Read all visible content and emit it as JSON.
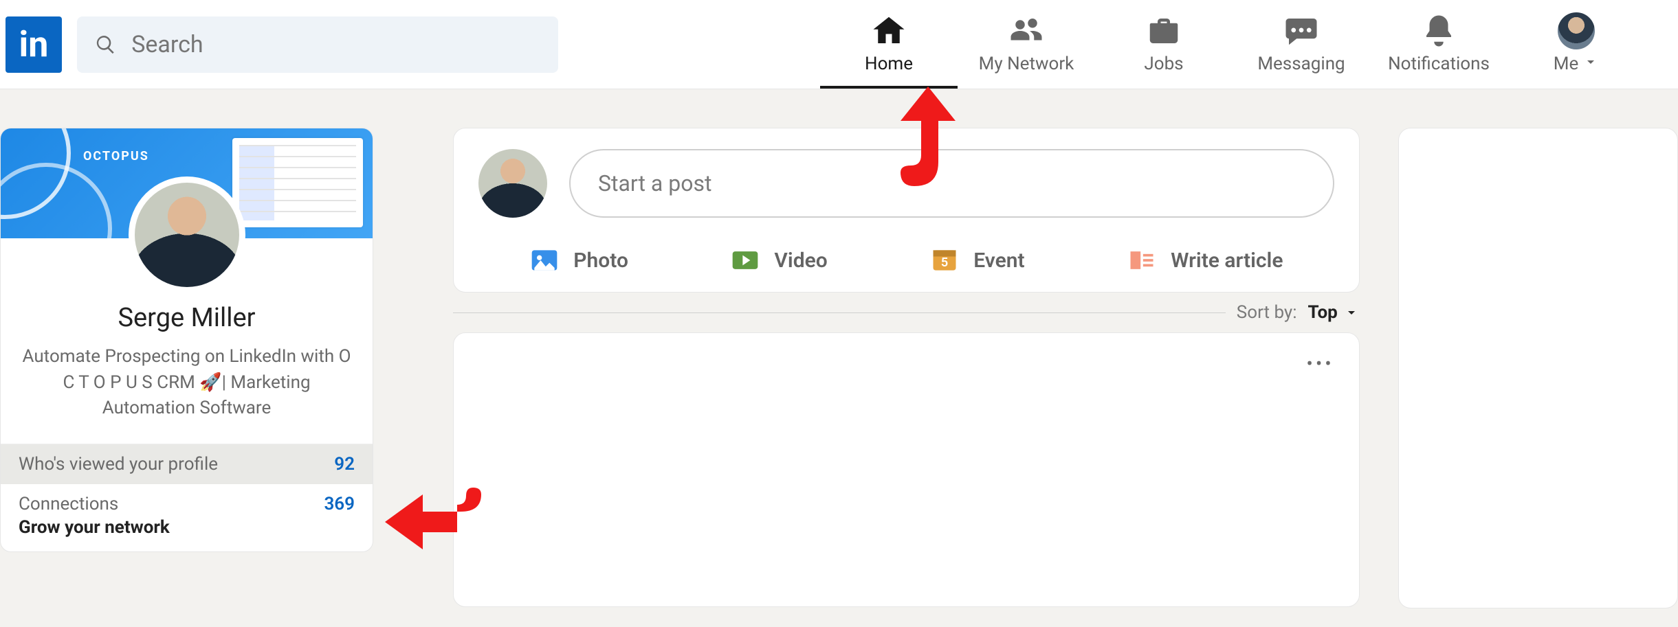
{
  "logo_text": "in",
  "search": {
    "placeholder": "Search"
  },
  "nav": {
    "home": "Home",
    "network": "My Network",
    "jobs": "Jobs",
    "messaging": "Messaging",
    "notifications": "Notifications",
    "me": "Me"
  },
  "profile": {
    "cover_brand": "OCTOPUS",
    "name": "Serge Miller",
    "tagline": "Automate Prospecting on LinkedIn with O C T O P U S CRM 🚀| Marketing Automation Software"
  },
  "stats": {
    "viewed_label": "Who's viewed your profile",
    "viewed_value": "92",
    "connections_label": "Connections",
    "connections_value": "369",
    "grow_label": "Grow your network"
  },
  "compose": {
    "placeholder": "Start a post",
    "photo": "Photo",
    "video": "Video",
    "event": "Event",
    "article": "Write article"
  },
  "sort": {
    "prefix": "Sort by:",
    "value": "Top"
  },
  "feed": {
    "more": "•••"
  }
}
